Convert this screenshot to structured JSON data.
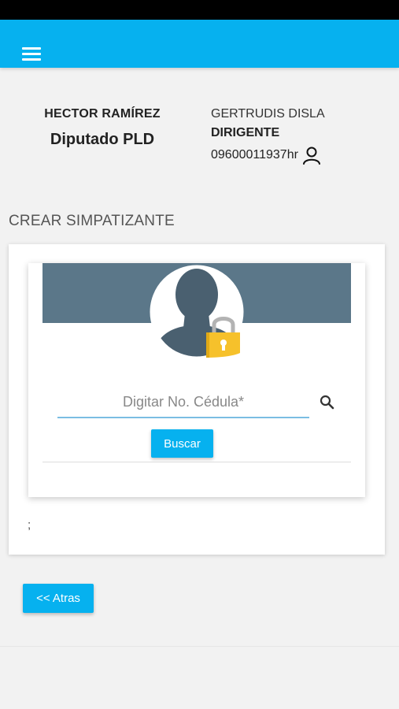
{
  "theme": {
    "accent": "#06b1ef",
    "banner": "#5b7789",
    "background": "#f2f2f2"
  },
  "appbar": {
    "menu_icon": "hamburger-menu-icon"
  },
  "header": {
    "left": {
      "name": "HECTOR RAMÍREZ",
      "role": "Diputado PLD"
    },
    "right": {
      "name": "GERTRUDIS DISLA",
      "role": "DIRIGENTE",
      "code": "09600011937hr",
      "icon": "user-outline-icon"
    }
  },
  "section": {
    "title": "CREAR SIMPATIZANTE"
  },
  "card": {
    "avatar_icon": "locked-user-avatar-icon",
    "search": {
      "placeholder": "Digitar No. Cédula*",
      "value": "",
      "icon": "search-icon"
    },
    "search_button": "Buscar",
    "note": ";"
  },
  "footer": {
    "back_button": "<< Atras"
  }
}
